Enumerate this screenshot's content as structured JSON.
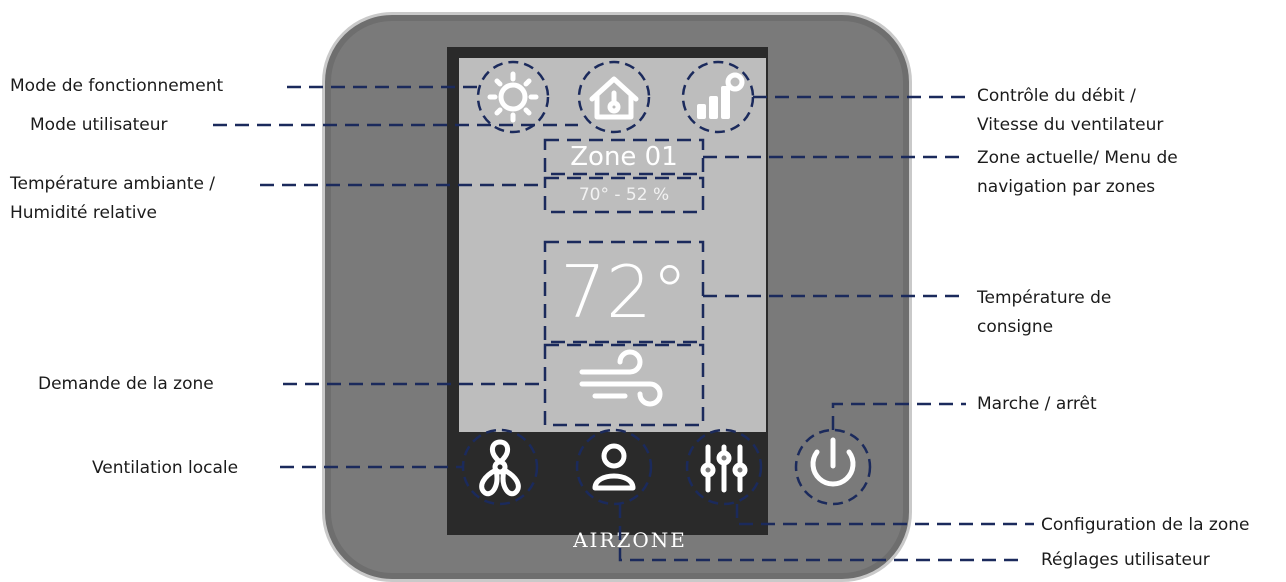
{
  "device": {
    "zone_name": "Zone 01",
    "ambient": "70° - 52 %",
    "setpoint": "72°",
    "brand": "AIRZONE"
  },
  "icons": {
    "top": [
      "sun-icon",
      "home-thermometer-icon",
      "fan-speed-bars-icon"
    ],
    "middle": "wind-demand-icon",
    "bottom": [
      "fan-icon",
      "user-icon",
      "sliders-icon",
      "power-icon"
    ]
  },
  "labels": {
    "mode_fonctionnement": "Mode de fonctionnement",
    "mode_utilisateur": "Mode utilisateur",
    "temp_ambiante_1": "Température ambiante /",
    "temp_ambiante_2": "Humidité relative",
    "demande_zone": "Demande de la zone",
    "ventilation_locale": "Ventilation locale",
    "controle_debit_1": "Contrôle du débit /",
    "controle_debit_2": "Vitesse du ventilateur",
    "zone_actuelle_1": "Zone actuelle/ Menu de",
    "zone_actuelle_2": "navigation par zones",
    "temp_consigne_1": "Température de",
    "temp_consigne_2": "consigne",
    "marche_arret": "Marche / arrêt",
    "config_zone": "Configuration de la zone",
    "reglages_utilisateur": "Réglages utilisateur"
  },
  "colors": {
    "leader": "#1b2a5c",
    "device_body": "#7a7a7a",
    "screen": "#bdbdbd"
  }
}
